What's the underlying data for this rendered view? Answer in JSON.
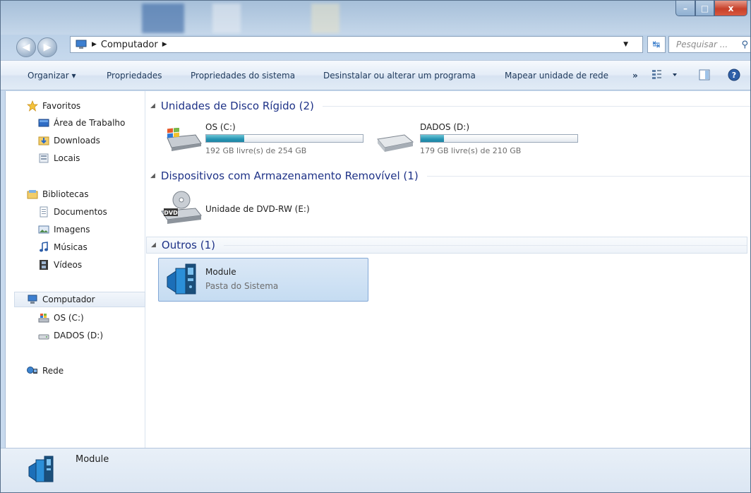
{
  "window": {
    "buttons": {
      "minimize": "–",
      "maximize": "□",
      "close": "x"
    }
  },
  "address": {
    "location": "Computador",
    "search_placeholder": "Pesquisar ..."
  },
  "toolbar": {
    "organize": "Organizar ▾",
    "properties": "Propriedades",
    "system_properties": "Propriedades do sistema",
    "uninstall": "Desinstalar ou alterar um programa",
    "map_drive": "Mapear unidade de rede",
    "more": "»"
  },
  "sidebar": {
    "favorites": {
      "label": "Favoritos",
      "items": [
        "Área de Trabalho",
        "Downloads",
        "Locais"
      ]
    },
    "libraries": {
      "label": "Bibliotecas",
      "items": [
        "Documentos",
        "Imagens",
        "Músicas",
        "Vídeos"
      ]
    },
    "computer": {
      "label": "Computador",
      "items": [
        "OS (C:)",
        "DADOS (D:)"
      ]
    },
    "network": {
      "label": "Rede"
    }
  },
  "groups": {
    "hard_disks": {
      "title": "Unidades de Disco Rígido (2)",
      "drives": [
        {
          "name": "OS (C:)",
          "free": "192 GB livre(s) de 254 GB",
          "used_fraction": 0.244
        },
        {
          "name": "DADOS (D:)",
          "free": "179 GB livre(s) de 210 GB",
          "used_fraction": 0.148
        }
      ]
    },
    "removable": {
      "title": "Dispositivos com Armazenamento Removível (1)",
      "items": [
        {
          "name": "Unidade de DVD-RW (E:)",
          "icon_text": "DVD"
        }
      ]
    },
    "others": {
      "title": "Outros (1)",
      "items": [
        {
          "name": "Module",
          "type": "Pasta do Sistema"
        }
      ]
    }
  },
  "details": {
    "name": "Module"
  },
  "colors": {
    "accent": "#1e3287",
    "bar_fill": "#2694b3",
    "selection": "#c5dcf2"
  }
}
